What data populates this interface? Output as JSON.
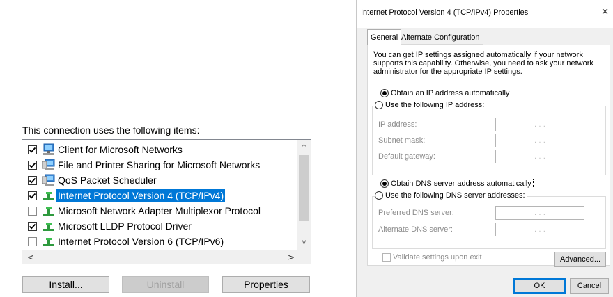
{
  "connection": {
    "heading": "This connection uses the following items:",
    "items": [
      {
        "label": "Client for Microsoft Networks",
        "checked": true,
        "icon": "network-client-icon",
        "selected": false
      },
      {
        "label": "File and Printer Sharing for Microsoft Networks",
        "checked": true,
        "icon": "network-service-icon",
        "selected": false
      },
      {
        "label": "QoS Packet Scheduler",
        "checked": true,
        "icon": "network-service-icon",
        "selected": false
      },
      {
        "label": "Internet Protocol Version 4 (TCP/IPv4)",
        "checked": true,
        "icon": "network-protocol-icon",
        "selected": true
      },
      {
        "label": "Microsoft Network Adapter Multiplexor Protocol",
        "checked": false,
        "icon": "network-protocol-icon",
        "selected": false
      },
      {
        "label": "Microsoft LLDP Protocol Driver",
        "checked": true,
        "icon": "network-protocol-icon",
        "selected": false
      },
      {
        "label": "Internet Protocol Version 6 (TCP/IPv6)",
        "checked": false,
        "icon": "network-protocol-icon",
        "selected": false
      }
    ],
    "scroll": {
      "up": "^",
      "down": "v",
      "left": "<",
      "right": ">"
    },
    "buttons": {
      "install": "Install...",
      "uninstall": "Uninstall",
      "properties": "Properties"
    }
  },
  "dialog": {
    "title": "Internet Protocol Version 4 (TCP/IPv4) Properties",
    "close": "✕",
    "tabs": [
      "General",
      "Alternate Configuration"
    ],
    "description": "You can get IP settings assigned automatically if your network supports this capability. Otherwise, you need to ask your network administrator for the appropriate IP settings.",
    "ip": {
      "auto_label": "Obtain an IP address automatically",
      "manual_label": "Use the following IP address:",
      "fields": [
        "IP address:",
        "Subnet mask:",
        "Default gateway:"
      ],
      "mode": "automatic"
    },
    "dns": {
      "auto_label": "Obtain DNS server address automatically",
      "manual_label": "Use the following DNS server addresses:",
      "fields": [
        "Preferred DNS server:",
        "Alternate DNS server:"
      ],
      "mode": "automatic"
    },
    "ip_placeholder": ".     .     .",
    "validate_label": "Validate settings upon exit",
    "buttons": {
      "advanced": "Advanced...",
      "ok": "OK",
      "cancel": "Cancel"
    }
  },
  "colors": {
    "selection": "#0078d7",
    "default_button_border": "#0078d7"
  }
}
